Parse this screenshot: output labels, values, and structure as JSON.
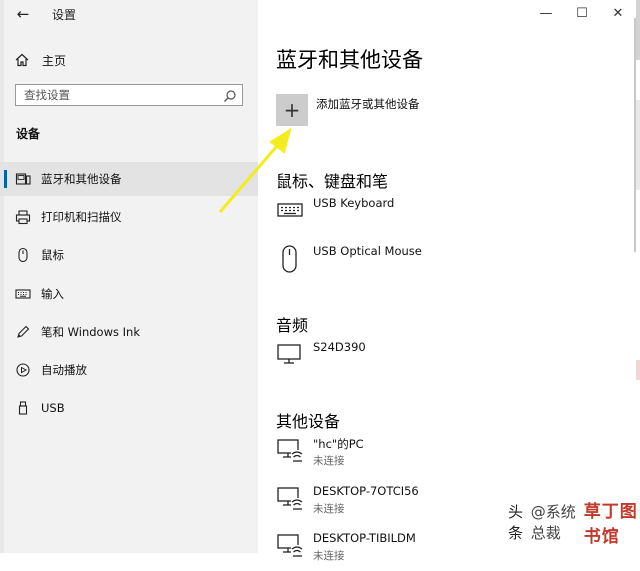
{
  "window": {
    "title": "设置",
    "controls": [
      "—",
      "☐",
      "✕"
    ]
  },
  "sidebar": {
    "home_label": "主页",
    "search_placeholder": "查找设置",
    "section_title": "设备",
    "items": [
      {
        "label": "蓝牙和其他设备",
        "icon": "bluetooth-devices-icon",
        "active": true
      },
      {
        "label": "打印机和扫描仪",
        "icon": "printer-icon",
        "active": false
      },
      {
        "label": "鼠标",
        "icon": "mouse-icon",
        "active": false
      },
      {
        "label": "输入",
        "icon": "keyboard-icon",
        "active": false
      },
      {
        "label": "笔和 Windows Ink",
        "icon": "pen-icon",
        "active": false
      },
      {
        "label": "自动播放",
        "icon": "autoplay-icon",
        "active": false
      },
      {
        "label": "USB",
        "icon": "usb-icon",
        "active": false
      }
    ]
  },
  "main": {
    "page_title": "蓝牙和其他设备",
    "add_label": "添加蓝牙或其他设备",
    "sections": [
      {
        "title": "鼠标、键盘和笔",
        "devices": [
          {
            "name": "USB Keyboard",
            "status": "",
            "icon": "keyboard-icon"
          },
          {
            "name": "USB Optical Mouse",
            "status": "",
            "icon": "mouse-icon"
          }
        ]
      },
      {
        "title": "音频",
        "devices": [
          {
            "name": "S24D390",
            "status": "",
            "icon": "monitor-icon"
          }
        ]
      },
      {
        "title": "其他设备",
        "devices": [
          {
            "name": "\"hc\"的PC",
            "status": "未连接",
            "icon": "network-pc-icon"
          },
          {
            "name": "DESKTOP-7OTCI56",
            "status": "未连接",
            "icon": "network-pc-icon"
          },
          {
            "name": "DESKTOP-TIBILDM",
            "status": "未连接",
            "icon": "network-pc-icon"
          }
        ]
      }
    ]
  },
  "annotation": {
    "arrow_color": "#f5ec1e"
  },
  "watermark": {
    "prefix": "头条",
    "handle": "@系统总裁",
    "stamp": "草丁图书馆"
  }
}
